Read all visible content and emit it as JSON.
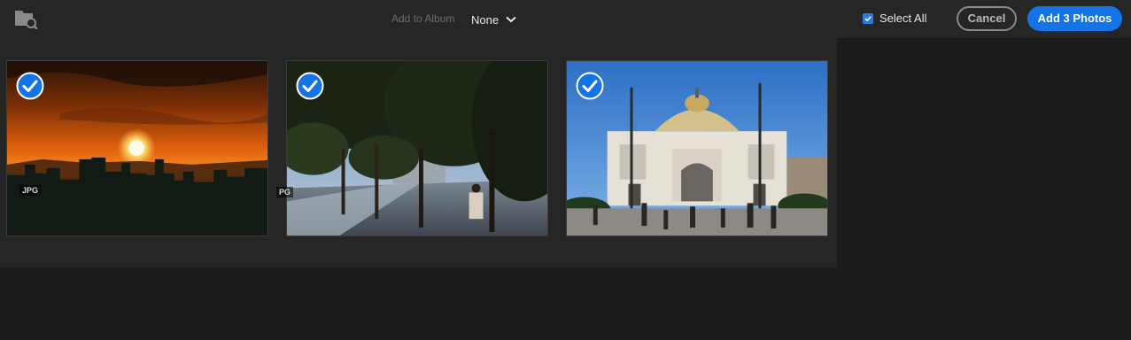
{
  "header": {
    "folder_icon": "folder-search-icon",
    "add_to_album_label": "Add to Album",
    "album_value": "None",
    "select_all_label": "Select All",
    "select_all_checked": true,
    "cancel_label": "Cancel",
    "add_label": "Add 3 Photos"
  },
  "colors": {
    "accent": "#1473e6",
    "topbar_bg": "#262626",
    "page_bg": "#1b1b1b"
  },
  "photos": [
    {
      "subject": "sunset-over-city",
      "badge": "JPG",
      "selected": true
    },
    {
      "subject": "tree-lined-street",
      "badge": "PG",
      "selected": true
    },
    {
      "subject": "palace-of-fine-arts",
      "badge": "",
      "selected": true
    }
  ]
}
